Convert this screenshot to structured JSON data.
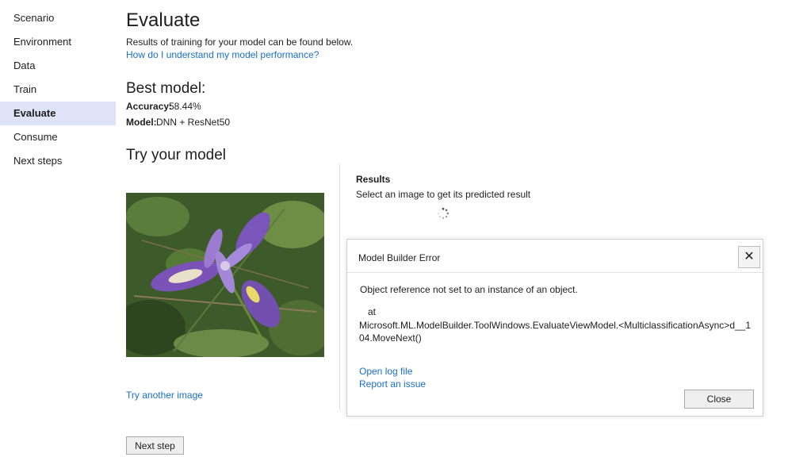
{
  "sidebar": {
    "items": [
      {
        "label": "Scenario",
        "active": false
      },
      {
        "label": "Environment",
        "active": false
      },
      {
        "label": "Data",
        "active": false
      },
      {
        "label": "Train",
        "active": false
      },
      {
        "label": "Evaluate",
        "active": true
      },
      {
        "label": "Consume",
        "active": false
      },
      {
        "label": "Next steps",
        "active": false
      }
    ]
  },
  "main": {
    "title": "Evaluate",
    "subtitle": "Results of training for your model can be found below.",
    "help_link": "How do I understand my model performance?",
    "best_model": {
      "heading": "Best model:",
      "accuracy_label": "Accuracy:",
      "accuracy_value": "58.44%",
      "model_label": "Model:",
      "model_value": "DNN + ResNet50"
    },
    "try_heading": "Try your model",
    "try_another": "Try another image",
    "next_step": "Next step"
  },
  "results": {
    "title": "Results",
    "description": "Select an image to get its predicted result"
  },
  "dialog": {
    "title": "Model Builder Error",
    "close_x": "✕",
    "message": "Object reference not set to an instance of an object.",
    "at": "at",
    "stack": "Microsoft.ML.ModelBuilder.ToolWindows.EvaluateViewModel.<MulticlassificationAsync>d__104.MoveNext()",
    "open_log": "Open log file",
    "report_issue": "Report an issue",
    "close_button": "Close"
  },
  "colors": {
    "accent_link": "#1a6fc9",
    "nav_active_bg": "#dfe3f7"
  },
  "icons": {
    "spinner": "loading-spinner-icon",
    "close": "close-icon"
  }
}
